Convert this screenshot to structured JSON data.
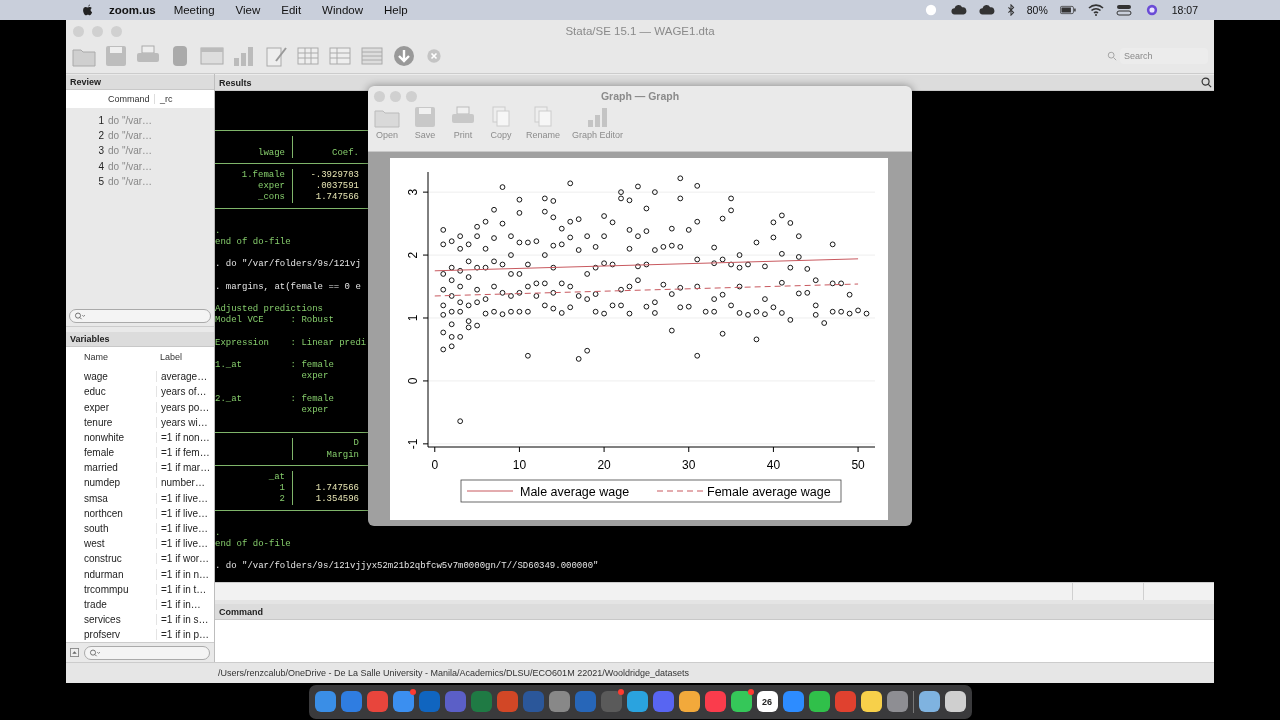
{
  "menubar": {
    "app": "zoom.us",
    "menus": [
      "Meeting",
      "View",
      "Edit",
      "Window",
      "Help"
    ],
    "battery": "80%",
    "clock": "18:07"
  },
  "window": {
    "title": "Stata/SE 15.1 — WAGE1.dta",
    "search": {
      "placeholder": "Search"
    }
  },
  "review": {
    "title": "Review",
    "columns": [
      "Command",
      "_rc"
    ],
    "rows": [
      {
        "index": "1",
        "command": "do \"/var…"
      },
      {
        "index": "2",
        "command": "do \"/var…"
      },
      {
        "index": "3",
        "command": "do \"/var…"
      },
      {
        "index": "4",
        "command": "do \"/var…"
      },
      {
        "index": "5",
        "command": "do \"/var…"
      }
    ]
  },
  "variables": {
    "title": "Variables",
    "columns": [
      "Name",
      "Label"
    ],
    "rows": [
      {
        "name": "wage",
        "label": "average…"
      },
      {
        "name": "educ",
        "label": "years of…"
      },
      {
        "name": "exper",
        "label": "years po…"
      },
      {
        "name": "tenure",
        "label": "years wi…"
      },
      {
        "name": "nonwhite",
        "label": "=1 if non…"
      },
      {
        "name": "female",
        "label": "=1 if fem…"
      },
      {
        "name": "married",
        "label": "=1 if mar…"
      },
      {
        "name": "numdep",
        "label": "number…"
      },
      {
        "name": "smsa",
        "label": "=1 if live…"
      },
      {
        "name": "northcen",
        "label": "=1 if live…"
      },
      {
        "name": "south",
        "label": "=1 if live…"
      },
      {
        "name": "west",
        "label": "=1 if live…"
      },
      {
        "name": "construc",
        "label": "=1 if wor…"
      },
      {
        "name": "ndurman",
        "label": "=1 if in n…"
      },
      {
        "name": "trcommpu",
        "label": "=1 if in t…"
      },
      {
        "name": "trade",
        "label": "=1 if in…"
      },
      {
        "name": "services",
        "label": "=1 if in s…"
      },
      {
        "name": "profserv",
        "label": "=1 if in p…"
      }
    ]
  },
  "results": {
    "title": "Results",
    "lines": [
      {
        "kind": "blank"
      },
      {
        "kind": "blank"
      },
      {
        "kind": "blank"
      },
      {
        "kind": "rule"
      },
      {
        "kind": "header"
      },
      {
        "kind": "header",
        "label": "lwage",
        "value": "Coef."
      },
      {
        "kind": "rule"
      },
      {
        "kind": "row",
        "label": "1.female",
        "value": "-.3929703"
      },
      {
        "kind": "row",
        "label": "exper",
        "value": ".0037591"
      },
      {
        "kind": "row",
        "label": "_cons",
        "value": "1.747566"
      },
      {
        "kind": "rule"
      },
      {
        "kind": "blank"
      },
      {
        "kind": "output",
        "text": "."
      },
      {
        "kind": "output",
        "text": "end of do-file"
      },
      {
        "kind": "blank"
      },
      {
        "kind": "command",
        "text": ". do \"/var/folders/9s/121vj"
      },
      {
        "kind": "blank"
      },
      {
        "kind": "command",
        "text": ". margins, at(female == 0 e"
      },
      {
        "kind": "blank"
      },
      {
        "kind": "output",
        "text": "Adjusted predictions"
      },
      {
        "kind": "output",
        "text": "Model VCE     : Robust"
      },
      {
        "kind": "blank"
      },
      {
        "kind": "output",
        "text": "Expression    : Linear predi"
      },
      {
        "kind": "blank"
      },
      {
        "kind": "output",
        "text": "1._at         : female"
      },
      {
        "kind": "output",
        "text": "                exper"
      },
      {
        "kind": "blank"
      },
      {
        "kind": "output",
        "text": "2._at         : female"
      },
      {
        "kind": "output",
        "text": "                exper"
      },
      {
        "kind": "blank"
      },
      {
        "kind": "rule"
      },
      {
        "kind": "header",
        "value": "D"
      },
      {
        "kind": "header",
        "value": "Margin"
      },
      {
        "kind": "rule"
      },
      {
        "kind": "row",
        "label": "_at"
      },
      {
        "kind": "row",
        "label": "1",
        "value": "1.747566"
      },
      {
        "kind": "row",
        "label": "2",
        "value": "1.354596"
      },
      {
        "kind": "rule"
      },
      {
        "kind": "blank"
      },
      {
        "kind": "output",
        "text": "."
      },
      {
        "kind": "output",
        "text": "end of do-file"
      },
      {
        "kind": "blank"
      },
      {
        "kind": "command",
        "text": ". do \"/var/folders/9s/121vjjyx52m21b2qbfcw5v7m0000gn/T//SD60349.000000\""
      }
    ]
  },
  "command": {
    "title": "Command"
  },
  "status_bar": {
    "path": "/Users/renzcalub/OneDrive - De La Salle University - Manila/Academics/DLSU/ECO601M 22021/Wooldridge_datasets"
  },
  "graph_window": {
    "title": "Graph — Graph",
    "toolbar": [
      {
        "kind": "open",
        "label": "Open"
      },
      {
        "kind": "save",
        "label": "Save"
      },
      {
        "kind": "print",
        "label": "Print"
      },
      {
        "kind": "copy",
        "label": "Copy"
      },
      {
        "kind": "rename",
        "label": "Rename"
      },
      {
        "kind": "editor",
        "label": "Graph Editor"
      }
    ],
    "chart_data": {
      "type": "scatter",
      "grid": true,
      "legend": "bottom",
      "xlim": [
        -0.8,
        52
      ],
      "ylim": [
        -1.05,
        3.32
      ],
      "xticks": [
        0,
        10,
        20,
        30,
        40,
        50
      ],
      "yticks": [
        -1,
        0,
        1,
        2,
        3
      ],
      "series": [
        {
          "type": "scatter",
          "color": "#000000",
          "x": [
            1,
            1,
            1,
            1,
            1,
            1,
            1,
            1,
            2,
            2,
            2,
            2,
            2,
            2,
            2,
            2,
            3,
            3,
            3,
            3,
            3,
            3,
            3,
            3,
            4,
            4,
            4,
            4,
            4,
            4,
            5,
            5,
            5,
            5,
            5,
            5,
            6,
            6,
            6,
            6,
            6,
            7,
            7,
            7,
            7,
            7,
            8,
            8,
            8,
            8,
            8,
            9,
            9,
            9,
            9,
            9,
            10,
            10,
            10,
            10,
            10,
            10,
            11,
            11,
            11,
            11,
            11,
            12,
            12,
            12,
            13,
            13,
            13,
            13,
            13,
            14,
            14,
            14,
            14,
            14,
            14,
            15,
            15,
            15,
            15,
            16,
            16,
            16,
            16,
            16,
            17,
            17,
            17,
            17,
            18,
            18,
            18,
            18,
            19,
            19,
            19,
            19,
            20,
            20,
            20,
            20,
            21,
            21,
            21,
            22,
            22,
            22,
            22,
            23,
            23,
            23,
            23,
            23,
            24,
            24,
            24,
            24,
            25,
            25,
            25,
            25,
            26,
            26,
            26,
            26,
            27,
            27,
            28,
            28,
            28,
            28,
            29,
            29,
            29,
            29,
            29,
            30,
            30,
            31,
            31,
            31,
            31,
            31,
            32,
            33,
            33,
            33,
            33,
            34,
            34,
            34,
            34,
            35,
            35,
            35,
            35,
            36,
            36,
            36,
            36,
            37,
            37,
            38,
            38,
            38,
            39,
            39,
            39,
            40,
            40,
            40,
            41,
            41,
            41,
            41,
            42,
            42,
            42,
            43,
            43,
            43,
            44,
            44,
            45,
            45,
            45,
            46,
            47,
            47,
            47,
            48,
            48,
            49,
            49,
            50,
            51
          ],
          "values": [
            2.4,
            2.17,
            1.7,
            1.45,
            1.2,
            1.05,
            0.77,
            0.5,
            2.22,
            1.8,
            1.6,
            1.35,
            1.1,
            0.9,
            0.7,
            0.55,
            2.3,
            2.1,
            1.75,
            1.5,
            1.25,
            1.1,
            0.7,
            -0.64,
            2.17,
            1.9,
            1.65,
            1.2,
            0.95,
            0.85,
            2.45,
            2.3,
            1.8,
            1.45,
            1.25,
            0.88,
            2.53,
            2.1,
            1.8,
            1.3,
            1.07,
            2.72,
            2.27,
            1.9,
            1.5,
            1.1,
            3.08,
            2.5,
            1.85,
            1.4,
            1.06,
            2.3,
            2.0,
            1.7,
            1.35,
            1.1,
            2.88,
            2.67,
            2.2,
            1.7,
            1.4,
            1.1,
            2.2,
            1.85,
            1.5,
            1.1,
            0.4,
            2.22,
            1.55,
            1.35,
            2.9,
            2.69,
            2.0,
            1.55,
            1.2,
            2.86,
            2.6,
            2.15,
            1.8,
            1.4,
            1.15,
            2.42,
            2.17,
            1.55,
            1.08,
            3.14,
            2.53,
            2.28,
            1.5,
            1.17,
            2.57,
            2.08,
            1.35,
            0.35,
            2.3,
            1.7,
            1.3,
            0.48,
            2.13,
            1.8,
            1.38,
            1.1,
            2.62,
            2.3,
            1.87,
            1.07,
            2.52,
            1.85,
            1.2,
            3.0,
            2.9,
            1.45,
            1.2,
            2.87,
            2.4,
            2.1,
            1.5,
            1.07,
            3.09,
            2.3,
            1.82,
            1.6,
            2.74,
            2.38,
            1.85,
            1.18,
            3.0,
            2.08,
            1.25,
            1.08,
            2.13,
            1.53,
            2.42,
            2.15,
            1.38,
            0.8,
            3.22,
            2.9,
            2.13,
            1.48,
            1.17,
            2.4,
            1.18,
            3.1,
            2.53,
            1.93,
            1.5,
            0.4,
            1.1,
            2.12,
            1.87,
            1.3,
            1.1,
            2.58,
            1.93,
            1.37,
            0.75,
            2.9,
            2.71,
            1.85,
            1.2,
            2.0,
            1.8,
            1.5,
            1.08,
            1.85,
            1.05,
            2.2,
            1.1,
            0.66,
            1.82,
            1.3,
            1.06,
            2.52,
            2.28,
            1.17,
            2.63,
            2.02,
            1.56,
            1.08,
            2.51,
            1.8,
            0.97,
            2.3,
            1.97,
            1.39,
            1.78,
            1.4,
            1.6,
            1.2,
            1.05,
            0.92,
            2.17,
            1.55,
            1.1,
            1.55,
            1.1,
            1.37,
            1.07,
            1.12,
            1.07
          ]
        },
        {
          "type": "line",
          "line_style": "solid",
          "name": "Male average wage",
          "color": "#c8595f",
          "x": [
            0,
            50
          ],
          "values": [
            1.75,
            1.94
          ]
        },
        {
          "type": "line",
          "line_style": "dashed",
          "name": "Female average wage",
          "color": "#c8595f",
          "x": [
            0,
            50
          ],
          "values": [
            1.35,
            1.54
          ]
        }
      ]
    }
  },
  "dock": [
    {
      "color": "#3a8ee6",
      "badge": false
    },
    {
      "color": "#2f7de1",
      "badge": false
    },
    {
      "color": "#e8453c",
      "badge": false
    },
    {
      "color": "#3b8ff0",
      "badge": true
    },
    {
      "color": "#1065c0",
      "badge": false
    },
    {
      "color": "#5b5fc7",
      "badge": false
    },
    {
      "color": "#1f7a44",
      "badge": false
    },
    {
      "color": "#d24726",
      "badge": false
    },
    {
      "color": "#2b579a",
      "badge": false
    },
    {
      "color": "#888888",
      "badge": false
    },
    {
      "color": "#2766b8",
      "badge": false
    },
    {
      "color": "#5a5a5a",
      "badge": true
    },
    {
      "color": "#2aa3df",
      "badge": false
    },
    {
      "color": "#5865f2",
      "badge": false
    },
    {
      "color": "#f2a93b",
      "badge": false
    },
    {
      "color": "#fa3c4c",
      "badge": false
    },
    {
      "color": "#35c759",
      "badge": true
    },
    {
      "color": "#ffffff",
      "badge": false,
      "label": "26"
    },
    {
      "color": "#2d8cff",
      "badge": false
    },
    {
      "color": "#30c04a",
      "badge": false
    },
    {
      "color": "#e0412f",
      "badge": false
    },
    {
      "color": "#f7d04a",
      "badge": false
    },
    {
      "color": "#8e8e93",
      "badge": false
    },
    {
      "color": "#7fb3e0",
      "badge": false
    },
    {
      "color": "#cfcfcf",
      "badge": false
    }
  ]
}
